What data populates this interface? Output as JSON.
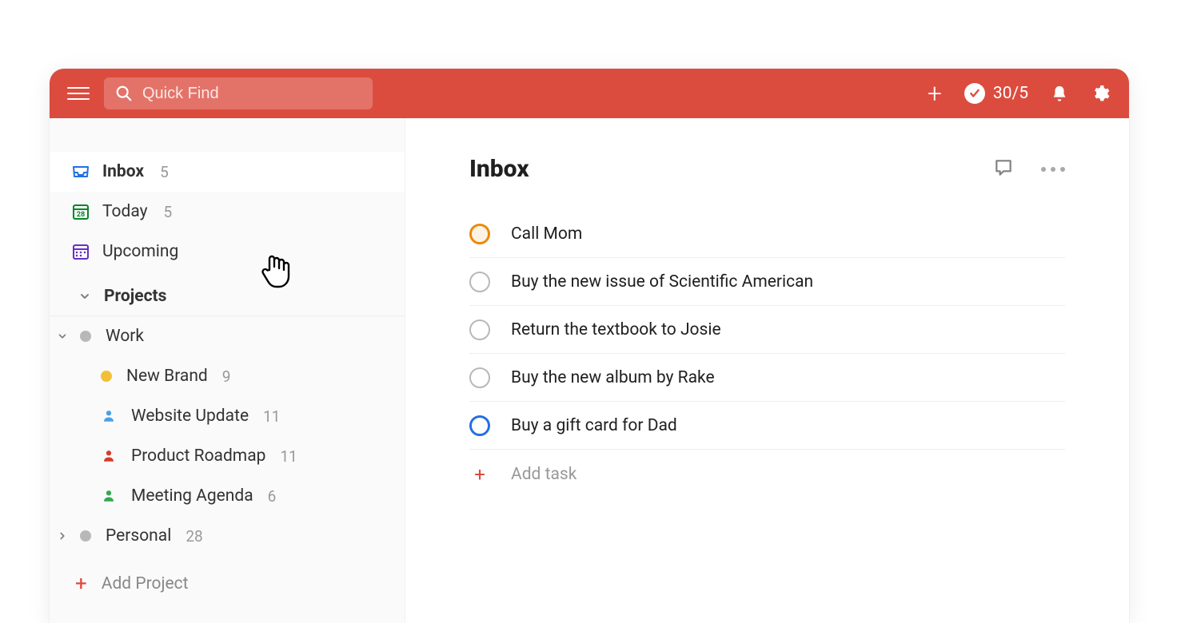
{
  "header": {
    "search_placeholder": "Quick Find",
    "goal_text": "30/5"
  },
  "sidebar": {
    "nav": [
      {
        "label": "Inbox",
        "count": "5",
        "selected": true,
        "icon": "inbox"
      },
      {
        "label": "Today",
        "count": "5",
        "selected": false,
        "icon": "today"
      },
      {
        "label": "Upcoming",
        "count": "",
        "selected": false,
        "icon": "upcoming"
      }
    ],
    "projects_header": "Projects",
    "top_projects": [
      {
        "label": "Work",
        "count": "",
        "expanded": true,
        "dot": "#b8b8b8"
      },
      {
        "label": "Personal",
        "count": "28",
        "expanded": false,
        "dot": "#b8b8b8"
      }
    ],
    "work_children": [
      {
        "label": "New Brand",
        "count": "9",
        "lead": "dot",
        "color": "#f2c037"
      },
      {
        "label": "Website Update",
        "count": "11",
        "lead": "person",
        "color": "#4aa0e8"
      },
      {
        "label": "Product Roadmap",
        "count": "11",
        "lead": "person",
        "color": "#d93a2b"
      },
      {
        "label": "Meeting Agenda",
        "count": "6",
        "lead": "person",
        "color": "#33a852"
      }
    ],
    "add_project_label": "Add Project"
  },
  "main": {
    "title": "Inbox",
    "tasks": [
      {
        "title": "Call Mom",
        "priority": "p2"
      },
      {
        "title": "Buy the new issue of Scientific American",
        "priority": ""
      },
      {
        "title": "Return the textbook to Josie",
        "priority": ""
      },
      {
        "title": "Buy the new album by Rake",
        "priority": ""
      },
      {
        "title": "Buy a gift card for Dad",
        "priority": "p1"
      }
    ],
    "add_task_label": "Add task"
  }
}
